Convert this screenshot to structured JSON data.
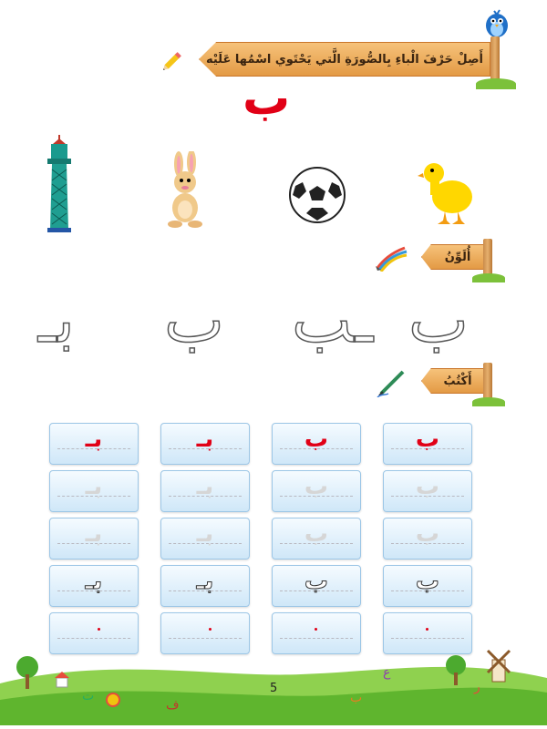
{
  "instruction": "أَصِلْ حَرْفَ الْباءِ بِالصُّورَةِ الَّتي يَحْتَوي اسْمُها عَلَيْه",
  "main_letter": "ب",
  "color_label": "أُلَوِّنُ",
  "write_label": "أَكْتُبُ",
  "outline_letters": [
    "ب",
    "ـب",
    "ب",
    "بـ"
  ],
  "practice_columns": [
    {
      "letter": "ب"
    },
    {
      "letter": "ب"
    },
    {
      "letter": "بـ"
    },
    {
      "letter": "بـ"
    }
  ],
  "page_number": "5",
  "pictures": [
    "duck",
    "ball",
    "rabbit",
    "tower"
  ],
  "colors": {
    "red": "#e10016",
    "sign": "#f0b566",
    "card": "#d9eefc",
    "grass": "#7cc13a"
  }
}
